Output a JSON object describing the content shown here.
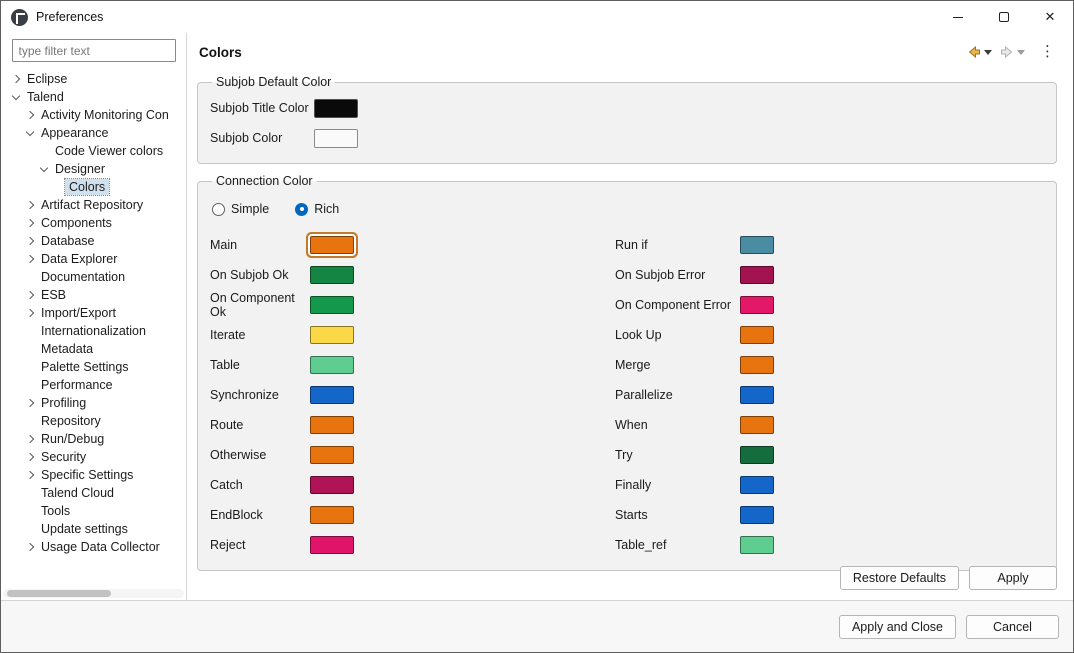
{
  "window": {
    "title": "Preferences",
    "controls": {
      "close": "✕"
    }
  },
  "sidebar": {
    "filter_placeholder": "type filter text",
    "tree": [
      {
        "label": "Eclipse",
        "level": 0,
        "state": "collapsed"
      },
      {
        "label": "Talend",
        "level": 0,
        "state": "expanded"
      },
      {
        "label": "Activity Monitoring Con",
        "level": 1,
        "state": "collapsed"
      },
      {
        "label": "Appearance",
        "level": 1,
        "state": "expanded"
      },
      {
        "label": "Code Viewer colors",
        "level": 2,
        "state": "leaf"
      },
      {
        "label": "Designer",
        "level": 2,
        "state": "expanded"
      },
      {
        "label": "Colors",
        "level": 3,
        "state": "leaf",
        "selected": true
      },
      {
        "label": "Artifact Repository",
        "level": 1,
        "state": "collapsed"
      },
      {
        "label": "Components",
        "level": 1,
        "state": "collapsed"
      },
      {
        "label": "Database",
        "level": 1,
        "state": "collapsed"
      },
      {
        "label": "Data Explorer",
        "level": 1,
        "state": "collapsed"
      },
      {
        "label": "Documentation",
        "level": 1,
        "state": "leaf"
      },
      {
        "label": "ESB",
        "level": 1,
        "state": "collapsed"
      },
      {
        "label": "Import/Export",
        "level": 1,
        "state": "collapsed"
      },
      {
        "label": "Internationalization",
        "level": 1,
        "state": "leaf"
      },
      {
        "label": "Metadata",
        "level": 1,
        "state": "leaf"
      },
      {
        "label": "Palette Settings",
        "level": 1,
        "state": "leaf"
      },
      {
        "label": "Performance",
        "level": 1,
        "state": "leaf"
      },
      {
        "label": "Profiling",
        "level": 1,
        "state": "collapsed"
      },
      {
        "label": "Repository",
        "level": 1,
        "state": "leaf"
      },
      {
        "label": "Run/Debug",
        "level": 1,
        "state": "collapsed"
      },
      {
        "label": "Security",
        "level": 1,
        "state": "collapsed"
      },
      {
        "label": "Specific Settings",
        "level": 1,
        "state": "collapsed"
      },
      {
        "label": "Talend Cloud",
        "level": 1,
        "state": "leaf"
      },
      {
        "label": "Tools",
        "level": 1,
        "state": "leaf"
      },
      {
        "label": "Update settings",
        "level": 1,
        "state": "leaf"
      },
      {
        "label": "Usage Data Collector",
        "level": 1,
        "state": "collapsed"
      }
    ]
  },
  "header": {
    "title": "Colors",
    "view_menu_glyph": "⋮"
  },
  "groups": {
    "subjob": {
      "title": "Subjob Default Color",
      "items": [
        {
          "label": "Subjob Title Color",
          "color": "#0a0a0a"
        },
        {
          "label": "Subjob Color",
          "color": "#fafafa"
        }
      ]
    },
    "connection": {
      "title": "Connection Color",
      "radios": [
        {
          "label": "Simple",
          "selected": false
        },
        {
          "label": "Rich",
          "selected": true
        }
      ],
      "left": [
        {
          "label": "Main",
          "color": "#E8740F",
          "focused": true
        },
        {
          "label": "On Subjob Ok",
          "color": "#158543"
        },
        {
          "label": "On Component Ok",
          "color": "#13984C"
        },
        {
          "label": "Iterate",
          "color": "#FBD848"
        },
        {
          "label": "Table",
          "color": "#5ECD8F"
        },
        {
          "label": "Synchronize",
          "color": "#1566C9"
        },
        {
          "label": "Route",
          "color": "#E8740F"
        },
        {
          "label": "Otherwise",
          "color": "#E8740F"
        },
        {
          "label": "Catch",
          "color": "#B01356"
        },
        {
          "label": "EndBlock",
          "color": "#E8740F"
        },
        {
          "label": "Reject",
          "color": "#E0156A"
        }
      ],
      "right": [
        {
          "label": "Run if",
          "color": "#4A8CA2"
        },
        {
          "label": "On Subjob Error",
          "color": "#A3134F"
        },
        {
          "label": "On Component Error",
          "color": "#E31869"
        },
        {
          "label": "Look Up",
          "color": "#E8740F"
        },
        {
          "label": "Merge",
          "color": "#E8740F"
        },
        {
          "label": "Parallelize",
          "color": "#1566C9"
        },
        {
          "label": "When",
          "color": "#E8740F"
        },
        {
          "label": "Try",
          "color": "#156C3C"
        },
        {
          "label": "Finally",
          "color": "#1566C9"
        },
        {
          "label": "Starts",
          "color": "#1566C9"
        },
        {
          "label": "Table_ref",
          "color": "#5ECD8F"
        }
      ]
    }
  },
  "actions": {
    "restore": "Restore Defaults",
    "apply": "Apply",
    "apply_close": "Apply and Close",
    "cancel": "Cancel"
  }
}
